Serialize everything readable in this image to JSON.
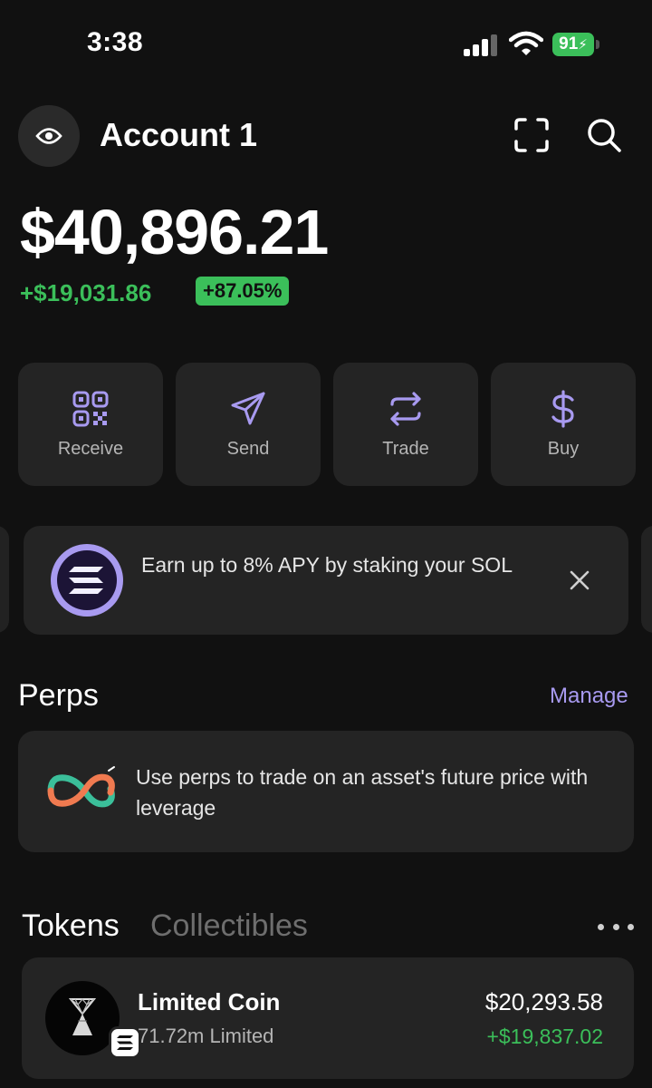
{
  "status_bar": {
    "time": "3:38",
    "battery": "91"
  },
  "header": {
    "account_name": "Account 1",
    "eye_icon": "eye-icon",
    "scan_icon": "scan-icon",
    "search_icon": "search-icon"
  },
  "balance": {
    "total": "$40,896.21",
    "change_amount": "+$19,031.86",
    "change_percent": "+87.05%"
  },
  "actions": [
    {
      "label": "Receive",
      "icon": "qr-code-icon"
    },
    {
      "label": "Send",
      "icon": "send-icon"
    },
    {
      "label": "Trade",
      "icon": "swap-icon"
    },
    {
      "label": "Buy",
      "icon": "dollar-icon"
    }
  ],
  "promo": {
    "text": "Earn up to 8% APY by staking your SOL",
    "icon": "solana-icon"
  },
  "perps": {
    "title": "Perps",
    "manage_label": "Manage",
    "description": "Use perps to trade on an asset's future price with leverage"
  },
  "tabs": {
    "tokens": "Tokens",
    "collectibles": "Collectibles"
  },
  "tokens": [
    {
      "name": "Limited Coin",
      "amount": "71.72m Limited",
      "value": "$20,293.58",
      "change": "+$19,837.02"
    }
  ],
  "colors": {
    "background": "#111111",
    "card": "#242424",
    "accent_purple": "#a89af0",
    "positive_green": "#3bbf5a"
  }
}
